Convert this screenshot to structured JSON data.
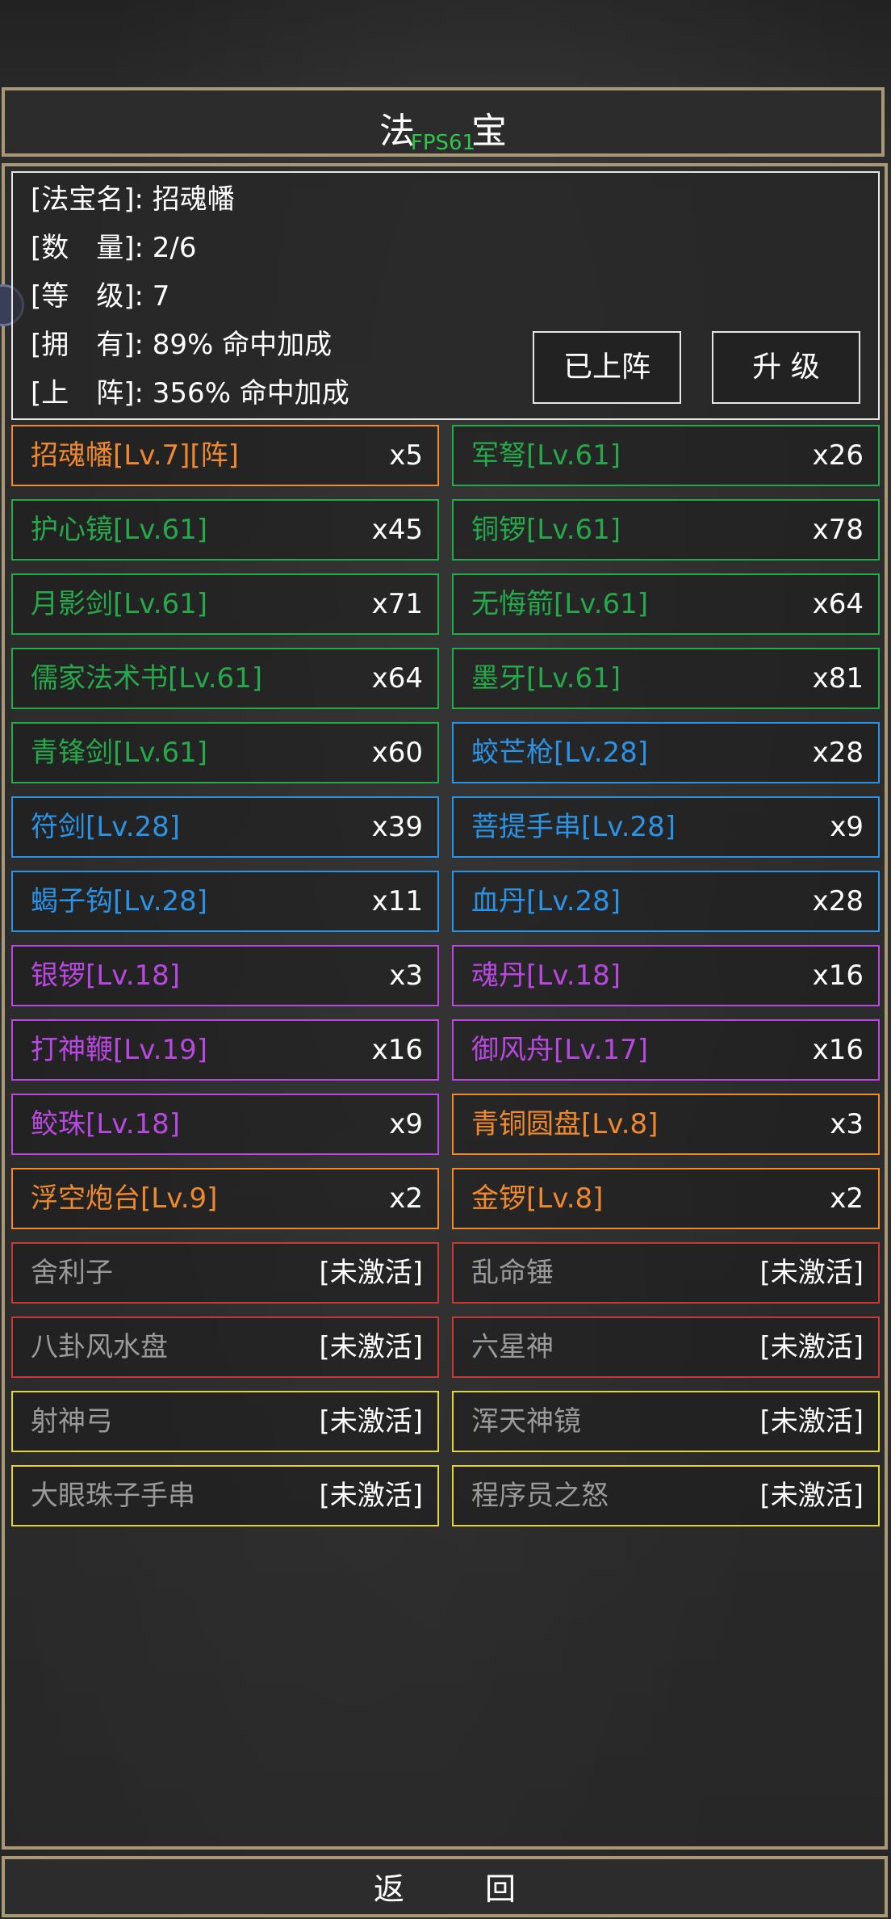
{
  "title": "法 宝",
  "fps": "FPS61",
  "info": {
    "lines": [
      {
        "label": "[法宝名]:",
        "value": "招魂幡"
      },
      {
        "label": "[数　量]:",
        "value": "2/6"
      },
      {
        "label": "[等　级]:",
        "value": "7"
      },
      {
        "label": "[拥　有]:",
        "value": "89% 命中加成"
      },
      {
        "label": "[上　阵]:",
        "value": "356% 命中加成"
      }
    ],
    "deploy_button": "已上阵",
    "upgrade_button": "升 级"
  },
  "colors": {
    "orange": "#f0892d",
    "green": "#25a94a",
    "blue": "#2b93e6",
    "purple": "#b848e0",
    "gray": "#9a9a9a",
    "red_border": "#c43a3a",
    "yellow_border": "#e1d43a",
    "gold_frame": "#a99876"
  },
  "items": [
    {
      "name": "招魂幡[Lv.7][阵]",
      "count": "x5",
      "tier": "orange"
    },
    {
      "name": "军弩[Lv.61]",
      "count": "x26",
      "tier": "green"
    },
    {
      "name": "护心镜[Lv.61]",
      "count": "x45",
      "tier": "green"
    },
    {
      "name": "铜锣[Lv.61]",
      "count": "x78",
      "tier": "green"
    },
    {
      "name": "月影剑[Lv.61]",
      "count": "x71",
      "tier": "green"
    },
    {
      "name": "无悔箭[Lv.61]",
      "count": "x64",
      "tier": "green"
    },
    {
      "name": "儒家法术书[Lv.61]",
      "count": "x64",
      "tier": "green"
    },
    {
      "name": "墨牙[Lv.61]",
      "count": "x81",
      "tier": "green"
    },
    {
      "name": "青锋剑[Lv.61]",
      "count": "x60",
      "tier": "green"
    },
    {
      "name": "蛟芒枪[Lv.28]",
      "count": "x28",
      "tier": "blue"
    },
    {
      "name": "符剑[Lv.28]",
      "count": "x39",
      "tier": "blue"
    },
    {
      "name": "菩提手串[Lv.28]",
      "count": "x9",
      "tier": "blue"
    },
    {
      "name": "蝎子钩[Lv.28]",
      "count": "x11",
      "tier": "blue"
    },
    {
      "name": "血丹[Lv.28]",
      "count": "x28",
      "tier": "blue"
    },
    {
      "name": "银锣[Lv.18]",
      "count": "x3",
      "tier": "purple"
    },
    {
      "name": "魂丹[Lv.18]",
      "count": "x16",
      "tier": "purple"
    },
    {
      "name": "打神鞭[Lv.19]",
      "count": "x16",
      "tier": "purple"
    },
    {
      "name": "御风舟[Lv.17]",
      "count": "x16",
      "tier": "purple"
    },
    {
      "name": "鲛珠[Lv.18]",
      "count": "x9",
      "tier": "purple"
    },
    {
      "name": "青铜圆盘[Lv.8]",
      "count": "x3",
      "tier": "orange"
    },
    {
      "name": "浮空炮台[Lv.9]",
      "count": "x2",
      "tier": "orange"
    },
    {
      "name": "金锣[Lv.8]",
      "count": "x2",
      "tier": "orange"
    },
    {
      "name": "舍利子",
      "count": "[未激活]",
      "tier": "red"
    },
    {
      "name": "乱命锤",
      "count": "[未激活]",
      "tier": "red"
    },
    {
      "name": "八卦风水盘",
      "count": "[未激活]",
      "tier": "red"
    },
    {
      "name": "六星神",
      "count": "[未激活]",
      "tier": "red"
    },
    {
      "name": "射神弓",
      "count": "[未激活]",
      "tier": "yellow"
    },
    {
      "name": "浑天神镜",
      "count": "[未激活]",
      "tier": "yellow"
    },
    {
      "name": "大眼珠子手串",
      "count": "[未激活]",
      "tier": "yellow"
    },
    {
      "name": "程序员之怒",
      "count": "[未激活]",
      "tier": "yellow"
    }
  ],
  "back_button": "返 回"
}
